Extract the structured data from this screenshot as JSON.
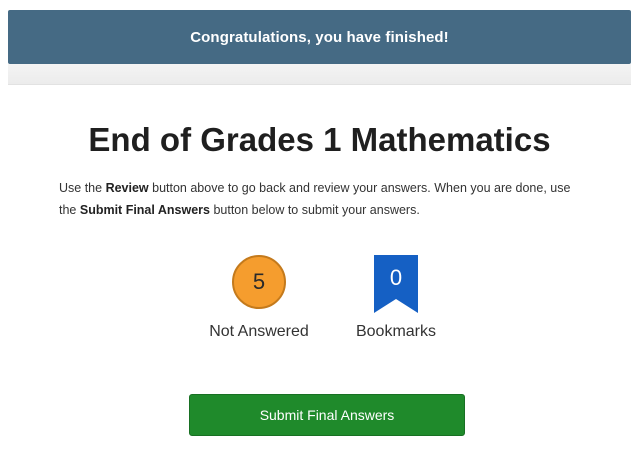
{
  "banner": {
    "message": "Congratulations, you have finished!"
  },
  "main": {
    "title": "End of Grades 1 Mathematics",
    "instructions": {
      "part1": "Use the ",
      "review_label": "Review",
      "part2": " button above to go back and review your answers. When you are done, use the ",
      "submit_label": "Submit Final Answers",
      "part3": " button below to submit your answers."
    },
    "stats": {
      "not_answered": {
        "count": "5",
        "label": "Not Answered",
        "color": "#f59d2e"
      },
      "bookmarks": {
        "count": "0",
        "label": "Bookmarks",
        "icon": "bookmark-icon",
        "color": "#1560c4"
      }
    },
    "submit_button": {
      "label": "Submit Final Answers",
      "color": "#1f8a2b"
    }
  },
  "colors": {
    "banner": "#456a84"
  }
}
